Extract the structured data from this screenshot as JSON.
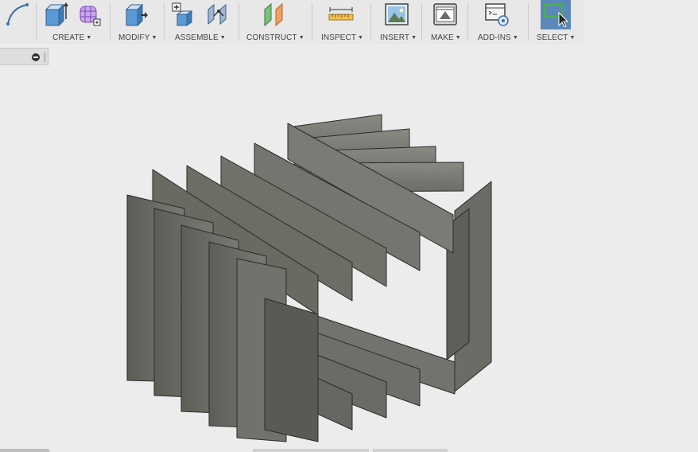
{
  "toolbar": {
    "groups": [
      {
        "label": "CREATE"
      },
      {
        "label": "MODIFY"
      },
      {
        "label": "ASSEMBLE"
      },
      {
        "label": "CONSTRUCT"
      },
      {
        "label": "INSPECT"
      },
      {
        "label": "INSERT"
      },
      {
        "label": "MAKE"
      },
      {
        "label": "ADD-INS"
      },
      {
        "label": "SELECT"
      }
    ],
    "caret": "▼"
  },
  "icons": {
    "sketch": "sketch-arc-icon",
    "extrude": "extrude-box-icon",
    "form": "form-mesh-icon",
    "press_pull": "press-pull-icon",
    "new_component": "new-component-icon",
    "joint": "joint-icon",
    "offset_plane": "offset-plane-icon",
    "measure": "measure-ruler-icon",
    "insert_image": "insert-image-icon",
    "print_3d": "3d-print-icon",
    "scripts": "scripts-addins-icon",
    "select": "select-window-icon"
  },
  "colors": {
    "select_active": "#5b88b8",
    "model_face": "#6e6e68",
    "model_edge": "#2a2a28"
  }
}
